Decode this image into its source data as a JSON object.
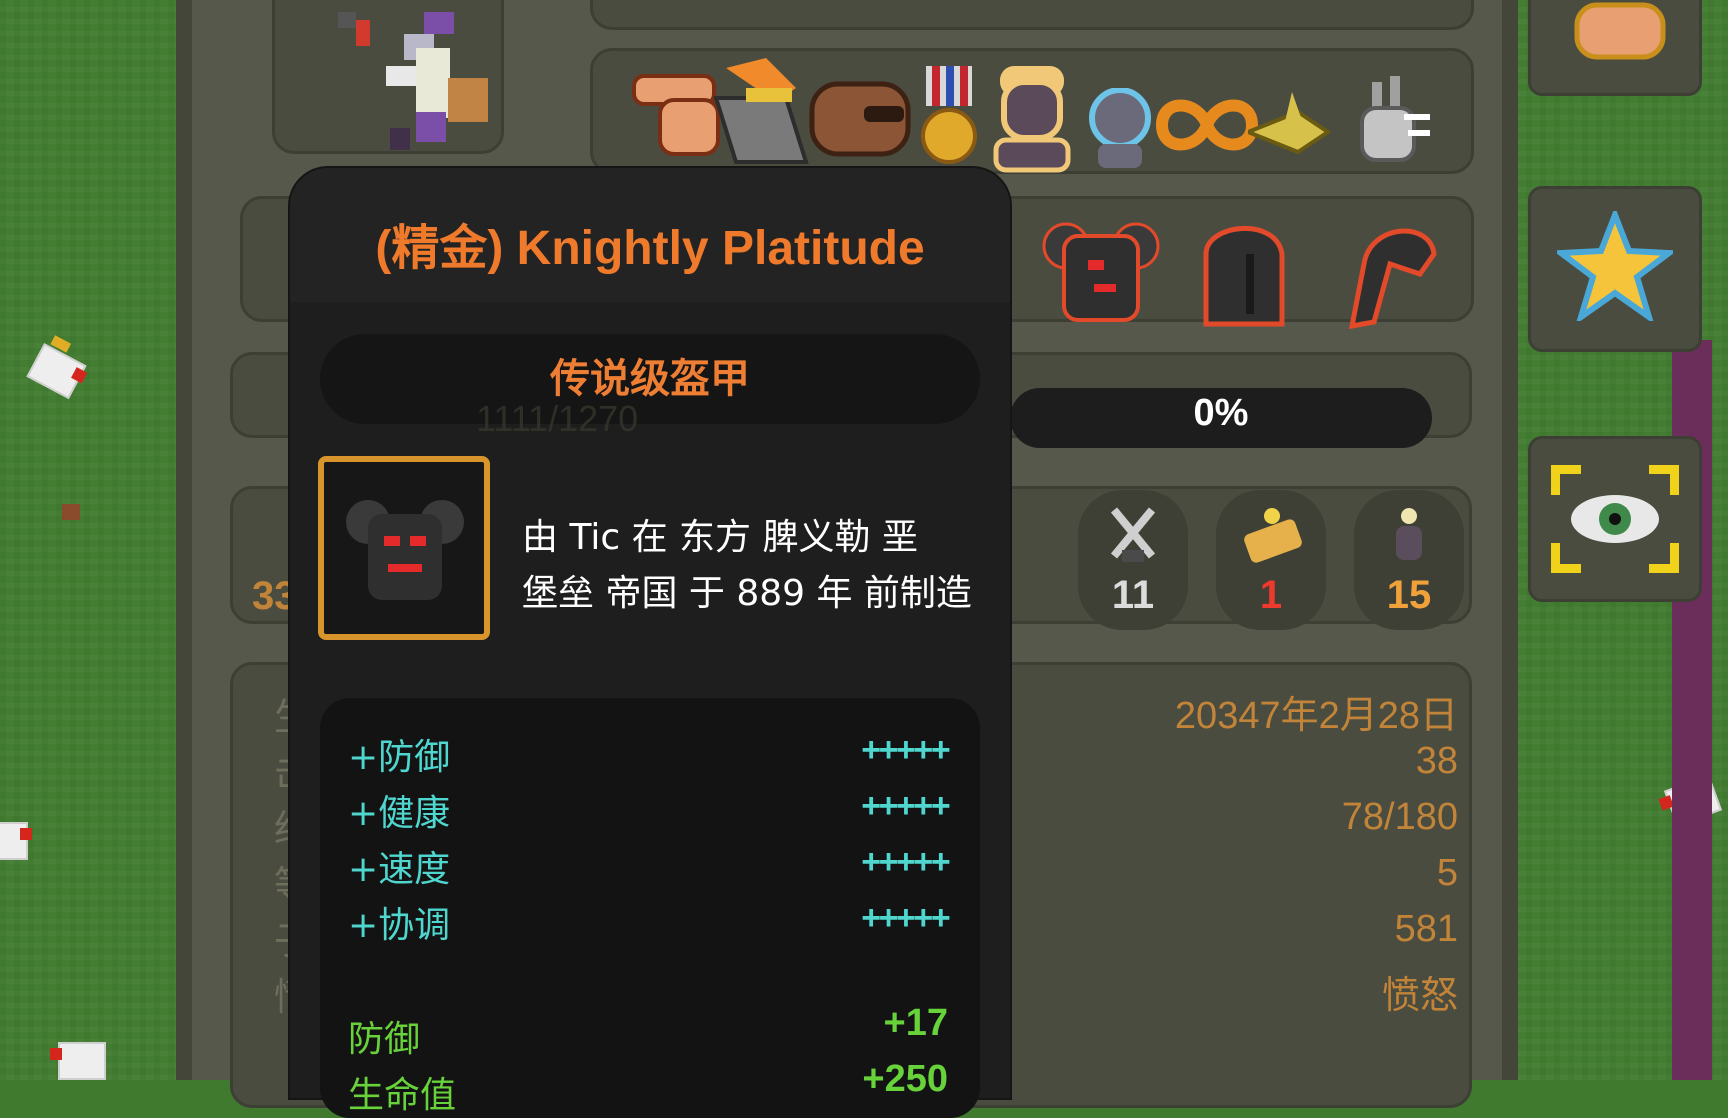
{
  "colors": {
    "title": "#ef7a2b",
    "attribute": "#4ed6cf",
    "bonus": "#67d23a",
    "info_value": "#c28438",
    "stat_white": "#dcdcdc",
    "stat_orange": "#f0a13a",
    "stat_red": "#ee3a2c"
  },
  "tooltip": {
    "title": "(精金) Knightly Platitude",
    "rarity": "传说级盔甲",
    "description_line1": "由 Tic 在 东方 脾义勒 垩",
    "description_line2": "堡垒 帝国 于 889 年 前制造",
    "attributes": [
      {
        "name": "+防御",
        "rating": "+++++"
      },
      {
        "name": "+健康",
        "rating": "+++++"
      },
      {
        "name": "+速度",
        "rating": "+++++"
      },
      {
        "name": "+协调",
        "rating": "+++++"
      }
    ],
    "bonuses": [
      {
        "name": "防御",
        "value": "+17"
      },
      {
        "name": "生命值",
        "value": "+250"
      }
    ]
  },
  "progress": {
    "label": "0%",
    "value": 0
  },
  "stats": [
    {
      "icon": "crossed-swords-icon",
      "value": "11"
    },
    {
      "icon": "scroll-coins-icon",
      "value": "1"
    },
    {
      "icon": "pawn-icon",
      "value": "15"
    }
  ],
  "info": {
    "partial_left_labels": [
      "生",
      "击",
      "经",
      "等",
      "子",
      "情"
    ],
    "partial_left_stat": "33",
    "partial_health": "1111/1270",
    "values": [
      "20347年2月28日",
      "38",
      "78/180",
      "5",
      "581",
      "愤怒"
    ]
  },
  "traits_icons": [
    "pointing-hand-icon",
    "flaming-axe-icon",
    "fist-icon",
    "medal-icon",
    "golden-head-icon",
    "ghost-head-icon",
    "infinity-icon",
    "golden-fish-icon",
    "running-rabbit-icon"
  ],
  "gear_icons": [
    "armor-chest-icon",
    "helmet-icon",
    "boot-icon"
  ],
  "side_buttons": [
    "hand-icon",
    "star-icon",
    "eye-icon"
  ]
}
